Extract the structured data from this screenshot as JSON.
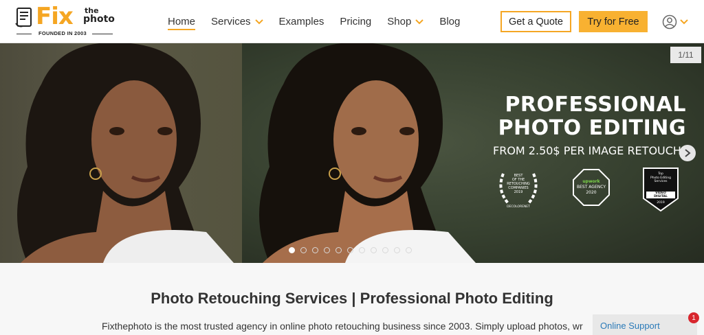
{
  "brand": {
    "logo_main": "Fix",
    "logo_the": "the",
    "logo_photo": "photo",
    "founded": "FOUNDED IN 2003",
    "accent_color": "#f5a623"
  },
  "nav": {
    "items": [
      {
        "label": "Home",
        "active": true,
        "dropdown": false
      },
      {
        "label": "Services",
        "active": false,
        "dropdown": true
      },
      {
        "label": "Examples",
        "active": false,
        "dropdown": false
      },
      {
        "label": "Pricing",
        "active": false,
        "dropdown": false
      },
      {
        "label": "Shop",
        "active": false,
        "dropdown": true
      },
      {
        "label": "Blog",
        "active": false,
        "dropdown": false
      }
    ],
    "quote_label": "Get a Quote",
    "try_label": "Try for Free",
    "user_icon": "user-circle-icon"
  },
  "hero": {
    "counter": "1/11",
    "title_line1": "PROFESSIONAL",
    "title_line2": "PHOTO EDITING",
    "subtitle": "FROM 2.50$ PER IMAGE RETOUCH",
    "badges": [
      {
        "lines": [
          "BEST",
          "OF THE",
          "RETOUCHING",
          "COMPANIES",
          "2019"
        ],
        "source": "DECOLORENET"
      },
      {
        "lines": [
          "upwork",
          "BEST AGENCY",
          "2020"
        ]
      },
      {
        "lines": [
          "Top",
          "Photo Editing",
          "Services",
          "VIDEO",
          "DIGITAL",
          "2019"
        ]
      }
    ],
    "dot_count": 11,
    "active_dot": 0
  },
  "content": {
    "title": "Photo Retouching Services | Professional Photo Editing",
    "intro": "Fixthephoto is the most trusted agency in online photo retouching business since 2003. Simply upload photos, write your"
  },
  "support": {
    "label": "Online Support",
    "badge_count": "1"
  }
}
